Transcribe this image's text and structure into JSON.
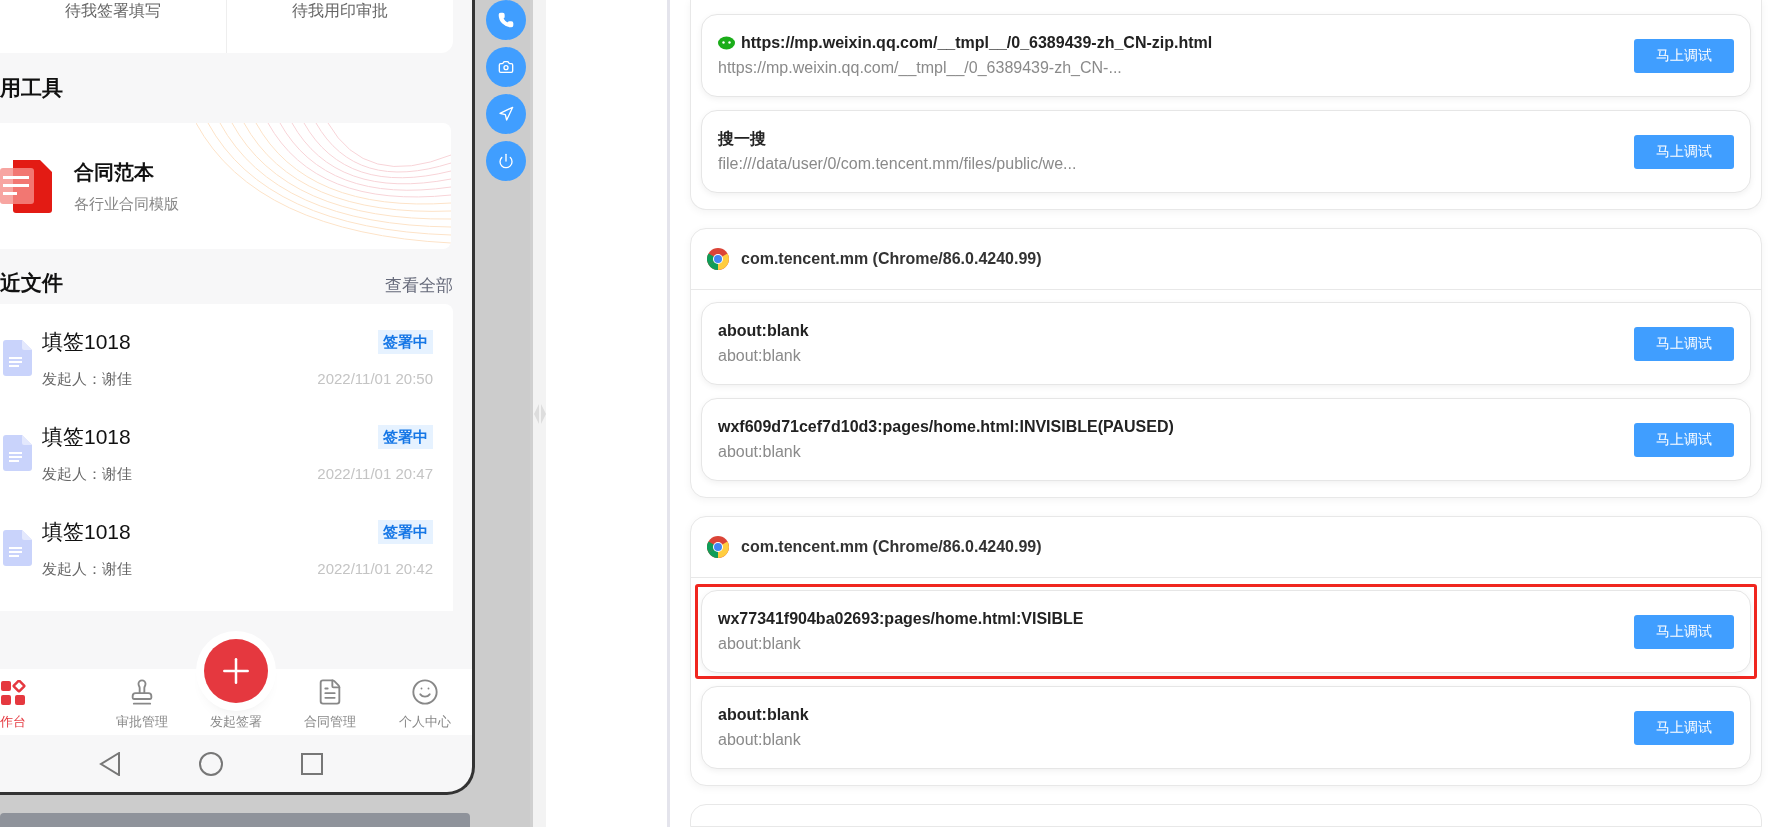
{
  "phone": {
    "top_tabs": [
      "待我签署填写",
      "待我用印审批"
    ],
    "tools": {
      "title": "用工具",
      "card": {
        "title": "合同范本",
        "subtitle": "各行业合同模版"
      }
    },
    "recent": {
      "title": "近文件",
      "link": "查看全部",
      "files": [
        {
          "title": "填签1018",
          "status": "签署中",
          "initiator": "发起人：谢佳",
          "time": "2022/11/01 20:50"
        },
        {
          "title": "填签1018",
          "status": "签署中",
          "initiator": "发起人：谢佳",
          "time": "2022/11/01 20:47"
        },
        {
          "title": "填签1018",
          "status": "签署中",
          "initiator": "发起人：谢佳",
          "time": "2022/11/01 20:42"
        }
      ]
    },
    "tab_bar": [
      {
        "label": "作台",
        "kind": "grid",
        "selected": true
      },
      {
        "label": "审批管理",
        "kind": "stamp",
        "selected": false
      },
      {
        "label": "发起签署",
        "kind": "plus",
        "selected": false
      },
      {
        "label": "合同管理",
        "kind": "document",
        "selected": false
      },
      {
        "label": "个人中心",
        "kind": "person",
        "selected": false
      }
    ]
  },
  "sessions": [
    {
      "items": [
        {
          "title": "https://mp.weixin.qq.com/__tmpl__/0_6389439-zh_CN-zip.html",
          "url": "https://mp.weixin.qq.com/__tmpl__/0_6389439-zh_CN-...",
          "kind": "wechat",
          "highlighted": false,
          "button": "马上调试"
        },
        {
          "title": "搜一搜",
          "url": "file:///data/user/0/com.tencent.mm/files/public/we...",
          "kind": "plain",
          "highlighted": false,
          "button": "马上调试"
        }
      ]
    },
    {
      "header": "com.tencent.mm (Chrome/86.0.4240.99)",
      "items": [
        {
          "title": "about:blank",
          "url": "about:blank",
          "kind": "plain",
          "highlighted": false,
          "button": "马上调试"
        },
        {
          "title": "wxf609d71cef7d10d3:pages/home.html:INVISIBLE(PAUSED)",
          "url": "about:blank",
          "kind": "plain",
          "highlighted": false,
          "button": "马上调试"
        }
      ]
    },
    {
      "header": "com.tencent.mm (Chrome/86.0.4240.99)",
      "items": [
        {
          "title": "wx77341f904ba02693:pages/home.html:VISIBLE",
          "url": "about:blank",
          "kind": "plain",
          "highlighted": true,
          "button": "马上调试"
        },
        {
          "title": "about:blank",
          "url": "about:blank",
          "kind": "plain",
          "highlighted": false,
          "button": "马上调试"
        }
      ]
    }
  ]
}
